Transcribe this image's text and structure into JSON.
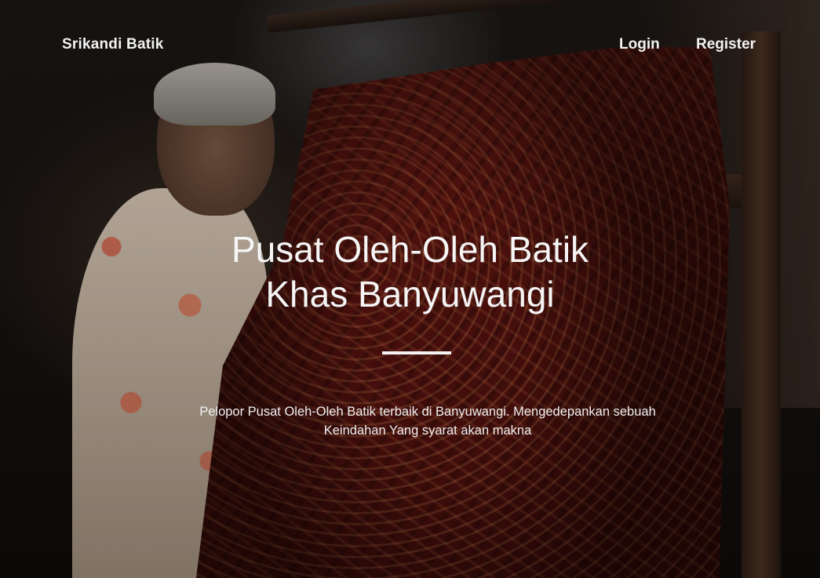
{
  "nav": {
    "brand": "Srikandi Batik",
    "login_label": "Login",
    "register_label": "Register"
  },
  "hero": {
    "headline_line1": "Pusat Oleh-Oleh Batik",
    "headline_line2": "Khas Banyuwangi",
    "subtitle_line1": "Pelopor Pusat Oleh-Oleh Batik terbaik di Banyuwangi. Mengedepankan sebuah",
    "subtitle_line2": "Keindahan Yang syarat akan makna"
  }
}
